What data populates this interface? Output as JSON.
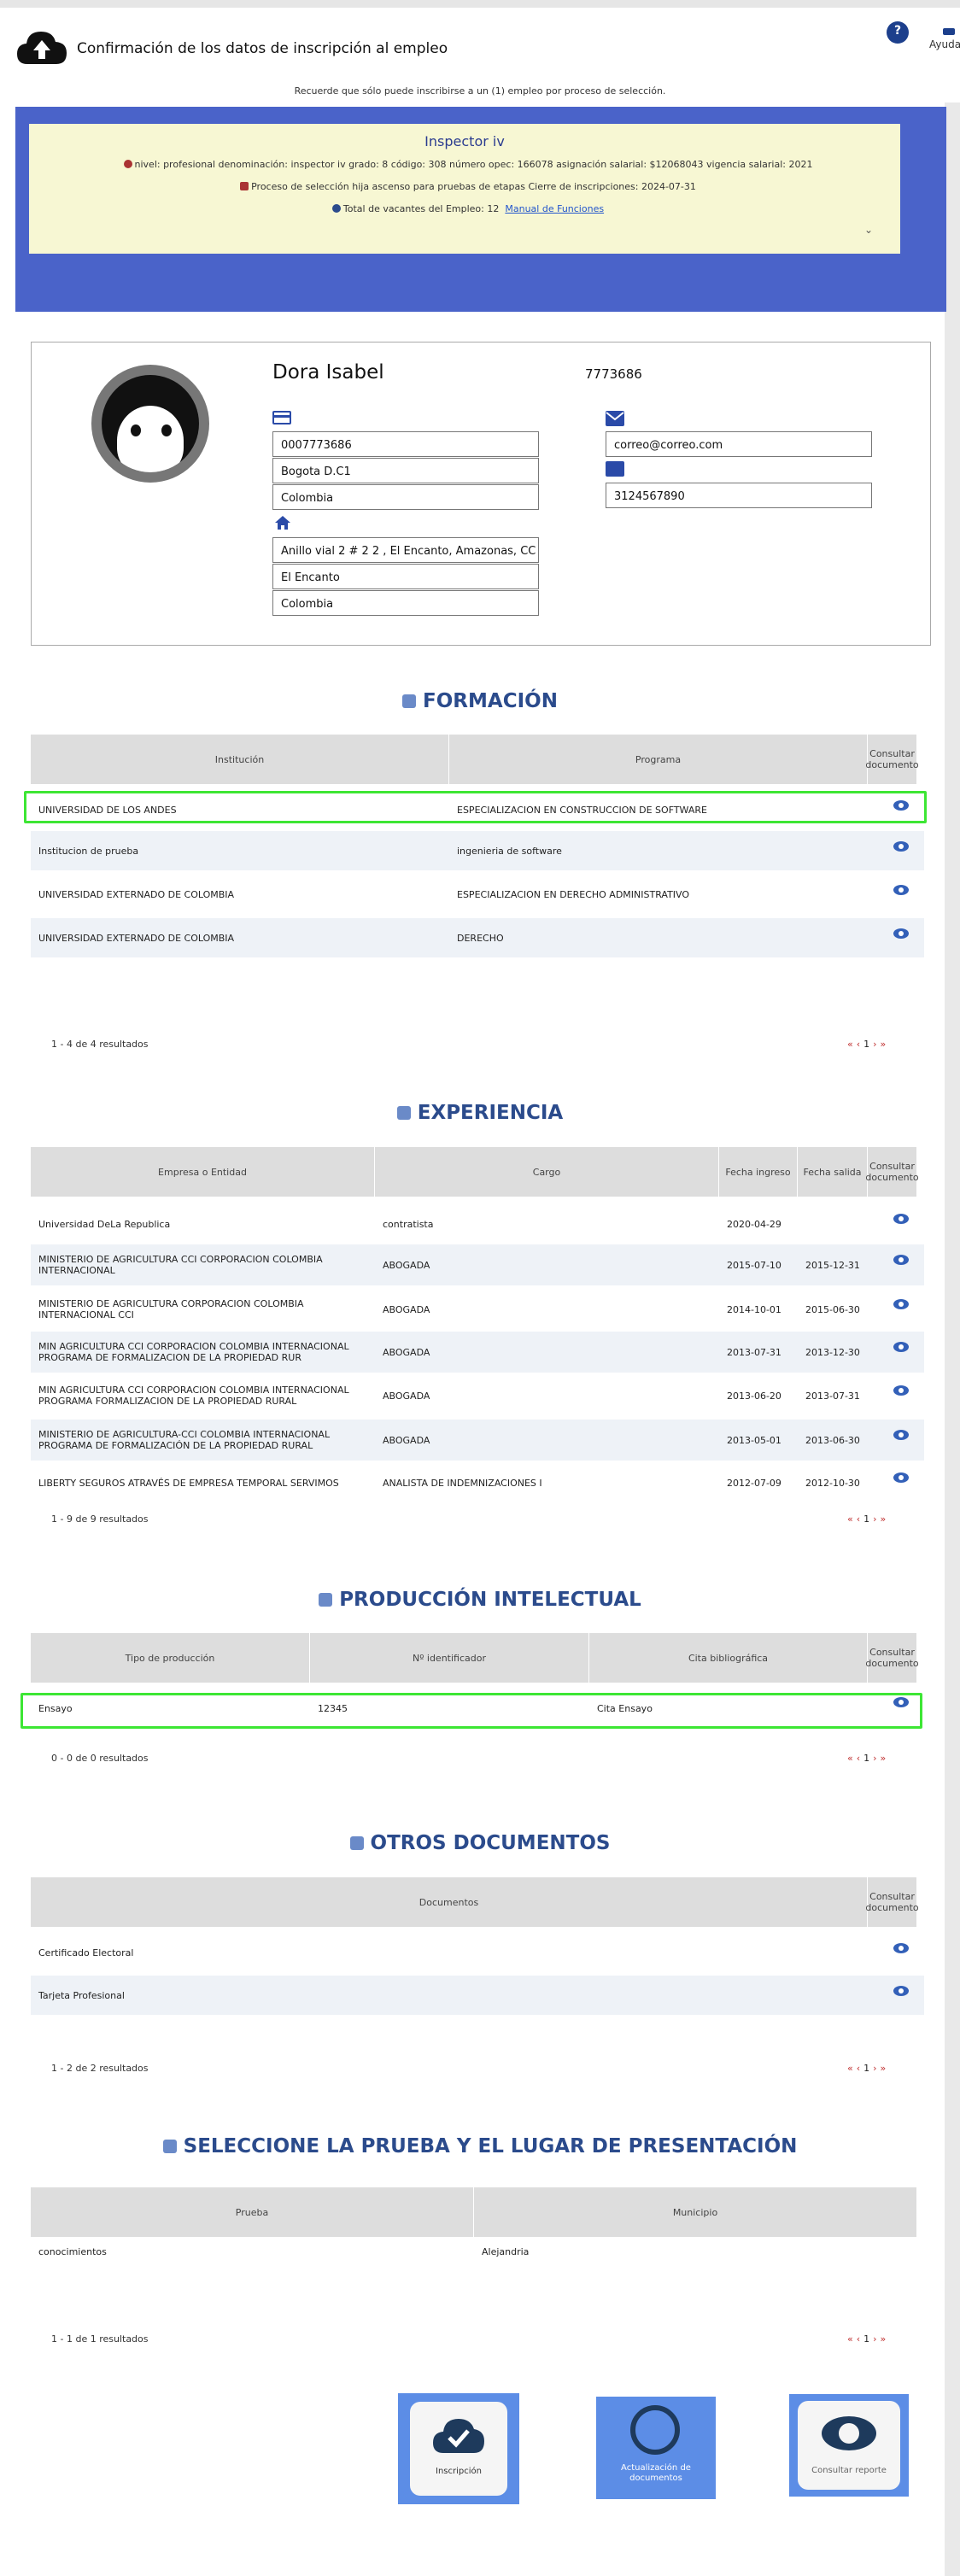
{
  "header": {
    "title": "Confirmación de los datos de inscripción al empleo",
    "help_label": "Ayuda",
    "notice": "Recuerde que sólo puede inscribirse a un (1) empleo por proceso de selección."
  },
  "job": {
    "name": "Inspector iv",
    "line1": "nivel: profesional  denominación: inspector iv  grado: 8  código: 308  número opec: 166078  asignación salarial: $12068043  vigencia salarial: 2021",
    "line2": "Proceso de selección hija ascenso para pruebas de etapas  Cierre de inscripciones: 2024-07-31",
    "line3_prefix": "Total de vacantes del Empleo: 12",
    "line3_link": "Manual de Funciones"
  },
  "profile": {
    "name": "Dora Isabel",
    "document": "7773686",
    "id_number": "0007773686",
    "city": "Bogota D.C1",
    "country": "Colombia",
    "email": "correo@correo.com",
    "phone": "3124567890",
    "address": "Anillo vial 2 # 2 2 , El Encanto, Amazonas, CC",
    "address_city": "El Encanto",
    "address_country": "Colombia"
  },
  "formacion": {
    "title": "FORMACIÓN",
    "headers": [
      "Institución",
      "Programa",
      "Consultar documento"
    ],
    "rows": [
      [
        "UNIVERSIDAD DE LOS ANDES",
        "ESPECIALIZACION EN CONSTRUCCION DE SOFTWARE"
      ],
      [
        "Institucion de prueba",
        "ingenieria de software"
      ],
      [
        "UNIVERSIDAD EXTERNADO DE COLOMBIA",
        "ESPECIALIZACION EN DERECHO ADMINISTRATIVO"
      ],
      [
        "UNIVERSIDAD EXTERNADO DE COLOMBIA",
        "DERECHO"
      ]
    ],
    "results": "1 - 4 de 4 resultados",
    "page": "1"
  },
  "experiencia": {
    "title": "EXPERIENCIA",
    "headers": [
      "Empresa o Entidad",
      "Cargo",
      "Fecha ingreso",
      "Fecha salida",
      "Consultar documento"
    ],
    "rows": [
      [
        "Universidad DeLa Republica",
        "contratista",
        "2020-04-29",
        ""
      ],
      [
        "MINISTERIO DE AGRICULTURA CCI CORPORACION COLOMBIA INTERNACIONAL",
        "ABOGADA",
        "2015-07-10",
        "2015-12-31"
      ],
      [
        "MINISTERIO DE AGRICULTURA CORPORACION COLOMBIA INTERNACIONAL CCI",
        "ABOGADA",
        "2014-10-01",
        "2015-06-30"
      ],
      [
        "MIN AGRICULTURA CCI CORPORACION COLOMBIA INTERNACIONAL PROGRAMA DE FORMALIZACION DE LA PROPIEDAD RUR",
        "ABOGADA",
        "2013-07-31",
        "2013-12-30"
      ],
      [
        "MIN AGRICULTURA CCI CORPORACION COLOMBIA INTERNACIONAL PROGRAMA FORMALIZACION DE LA PROPIEDAD RURAL",
        "ABOGADA",
        "2013-06-20",
        "2013-07-31"
      ],
      [
        "MINISTERIO DE AGRICULTURA-CCI COLOMBIA INTERNACIONAL PROGRAMA DE FORMALIZACIÓN DE LA PROPIEDAD RURAL",
        "ABOGADA",
        "2013-05-01",
        "2013-06-30"
      ],
      [
        "LIBERTY SEGUROS ATRAVÉS DE EMPRESA TEMPORAL SERVIMOS",
        "ANALISTA DE INDEMNIZACIONES I",
        "2012-07-09",
        "2012-10-30"
      ]
    ],
    "results": "1 - 9 de 9 resultados",
    "page": "1"
  },
  "produccion": {
    "title": "PRODUCCIÓN INTELECTUAL",
    "headers": [
      "Tipo de producción",
      "Nº identificador",
      "Cita bibliográfica",
      "Consultar documento"
    ],
    "rows": [
      [
        "Ensayo",
        "12345",
        "Cita Ensayo"
      ]
    ],
    "results": "0 - 0 de 0 resultados",
    "page": "1"
  },
  "otros": {
    "title": "OTROS DOCUMENTOS",
    "headers": [
      "Documentos",
      "Consultar documento"
    ],
    "rows": [
      [
        "Certificado Electoral"
      ],
      [
        "Tarjeta Profesional"
      ]
    ],
    "results": "1 - 2 de 2 resultados",
    "page": "1"
  },
  "prueba": {
    "title": "SELECCIONE LA PRUEBA Y EL LUGAR DE PRESENTACIÓN",
    "headers": [
      "Prueba",
      "Municipio"
    ],
    "rows": [
      [
        "conocimientos",
        "Alejandria"
      ]
    ],
    "results": "1 - 1 de 1 resultados",
    "page": "1"
  },
  "actions": {
    "inscripcion": "Inscripción",
    "actualizacion": "Actualización de documentos",
    "reporte": "Consultar reporte"
  },
  "colors": {
    "primary_blue": "#4a63c9",
    "section_title": "#2b4b8c",
    "highlight": "#3de634"
  }
}
